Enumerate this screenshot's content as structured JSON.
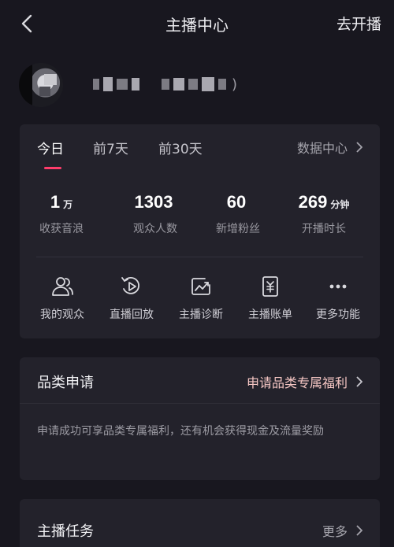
{
  "header": {
    "title": "主播中心",
    "go_live": "去开播"
  },
  "profile": {
    "name_suffix": ")"
  },
  "stats": {
    "tabs": [
      "今日",
      "前7天",
      "前30天"
    ],
    "active_tab": "今日",
    "data_center": "数据中心",
    "items": [
      {
        "value": "1",
        "unit": "万",
        "label": "收获音浪"
      },
      {
        "value": "1303",
        "unit": "",
        "label": "观众人数"
      },
      {
        "value": "60",
        "unit": "",
        "label": "新增粉丝"
      },
      {
        "value": "269",
        "unit": "分钟",
        "label": "开播时长"
      }
    ],
    "tools": [
      {
        "label": "我的观众",
        "icon": "audience-icon"
      },
      {
        "label": "直播回放",
        "icon": "replay-icon"
      },
      {
        "label": "主播诊断",
        "icon": "diagnosis-icon"
      },
      {
        "label": "主播账单",
        "icon": "bill-icon"
      },
      {
        "label": "更多功能",
        "icon": "more-icon"
      }
    ]
  },
  "category": {
    "title": "品类申请",
    "link": "申请品类专属福利",
    "description": "申请成功可享品类专属福利，还有机会获得现金及流量奖励"
  },
  "tasks": {
    "title": "主播任务",
    "more": "更多"
  },
  "colors": {
    "background": "#18171f",
    "card": "#23222b",
    "accent": "#ff3d6b",
    "link_pink": "#f6c7c4"
  }
}
